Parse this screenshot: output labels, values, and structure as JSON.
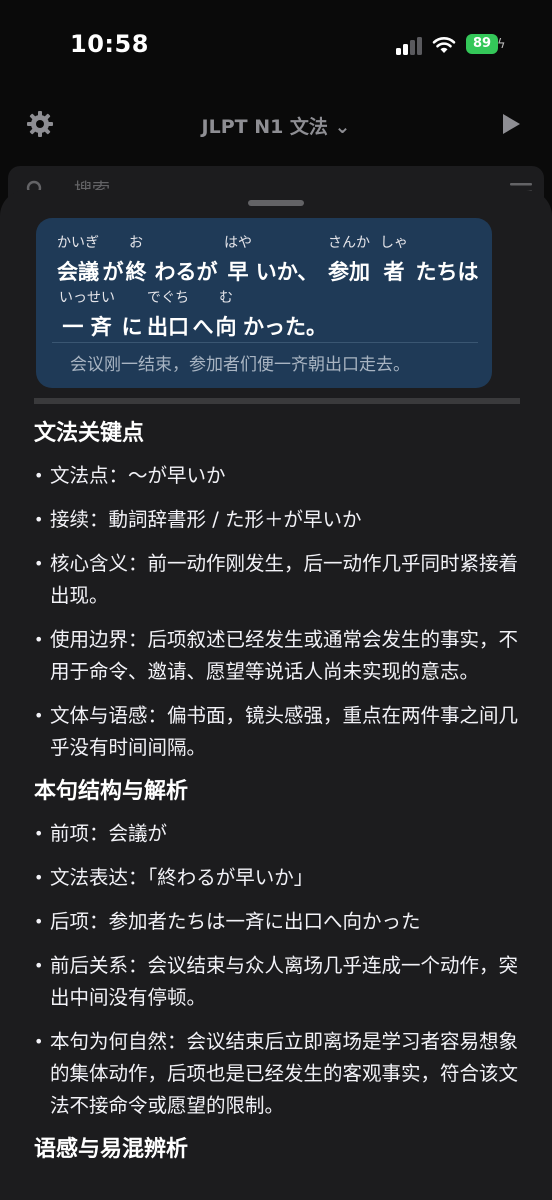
{
  "status": {
    "time": "10:58",
    "battery": "89"
  },
  "nav": {
    "title": "JLPT N1 文法 ⌄"
  },
  "search": {
    "placeholder": "搜索"
  },
  "sentence": {
    "line1": [
      {
        "rt": "かいぎ",
        "base": "会議"
      },
      {
        "rt": "",
        "base": "が"
      },
      {
        "rt": "お",
        "base": "終"
      },
      {
        "rt": "",
        "base": "わるが"
      },
      {
        "rt": "はや",
        "base": "早"
      },
      {
        "rt": "",
        "base": "いか、"
      },
      {
        "rt": "さんか",
        "base": "参加"
      },
      {
        "rt": "しゃ",
        "base": "者"
      },
      {
        "rt": "",
        "base": "たちは"
      }
    ],
    "line2": [
      {
        "rt": "いっせい",
        "base": "一 斉"
      },
      {
        "rt": "",
        "base": "に"
      },
      {
        "rt": "でぐち",
        "base": "出口"
      },
      {
        "rt": "",
        "base": "へ"
      },
      {
        "rt": "む",
        "base": "向"
      },
      {
        "rt": "",
        "base": "かった。"
      }
    ],
    "translation": "会议刚一结束，参加者们便一齐朝出口走去。"
  },
  "sections": [
    {
      "title": "文法关键点",
      "items": [
        "文法点：～が早いか",
        "接续：動詞辞書形 / た形＋が早いか",
        "核心含义：前一动作刚发生，后一动作几乎同时紧接着出现。",
        "使用边界：后项叙述已经发生或通常会发生的事实，不用于命令、邀请、愿望等说话人尚未实现的意志。",
        "文体与语感：偏书面，镜头感强，重点在两件事之间几乎没有时间间隔。"
      ]
    },
    {
      "title": "本句结构与解析",
      "items": [
        "前项：会議が",
        "文法表达：「終わるが早いか」",
        "后项：参加者たちは一斉に出口へ向かった",
        "前后关系：会议结束与众人离场几乎连成一个动作，突出中间没有停顿。",
        "本句为何自然：会议结束后立即离场是学习者容易想象的集体动作，后项也是已经发生的客观事实，符合该文法不接命令或愿望的限制。"
      ]
    },
    {
      "title": "语感与易混辨析",
      "items": []
    }
  ]
}
